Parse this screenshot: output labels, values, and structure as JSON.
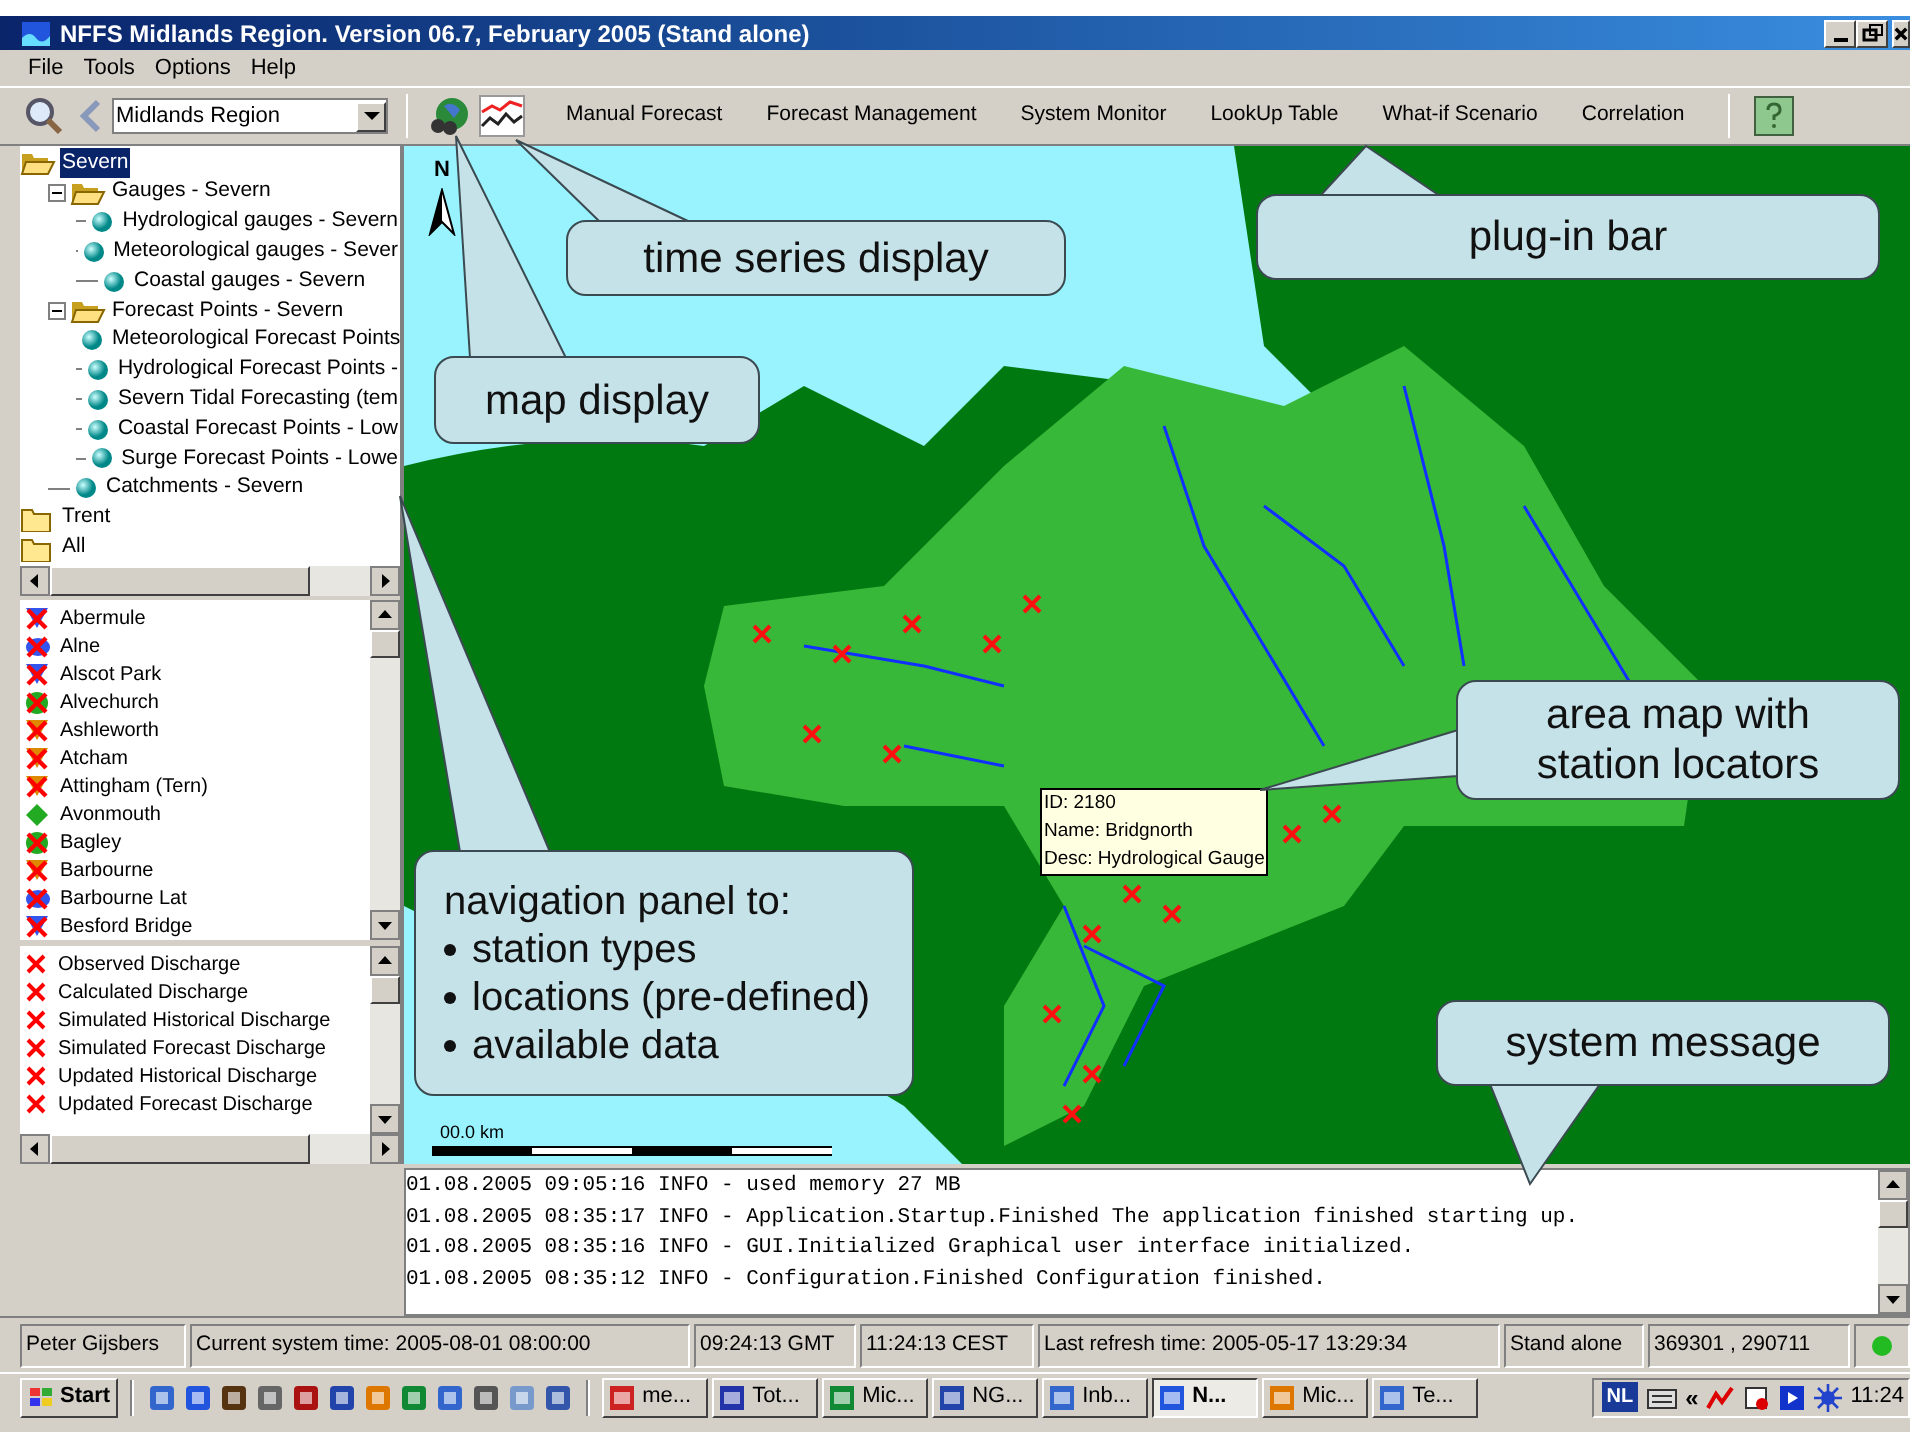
{
  "window": {
    "title": "NFFS Midlands Region. Version 06.7, February 2005  (Stand alone)"
  },
  "menu": [
    "File",
    "Tools",
    "Options",
    "Help"
  ],
  "toolbar": {
    "region": "Midlands Region",
    "plugins": [
      "Manual Forecast",
      "Forecast Management",
      "System Monitor",
      "LookUp Table",
      "What-if Scenario",
      "Correlation"
    ]
  },
  "tree": [
    {
      "label": "Severn",
      "kind": "folder",
      "expanded": true,
      "selected": true,
      "children": [
        {
          "label": "Gauges - Severn",
          "kind": "folder",
          "expanded": true,
          "selected": false,
          "children": [
            {
              "label": "Hydrological gauges - Severn",
              "kind": "layer",
              "selected": false
            },
            {
              "label": "Meteorological gauges - Sever",
              "kind": "layer",
              "selected": false
            },
            {
              "label": "Coastal gauges - Severn",
              "kind": "layer",
              "selected": false
            }
          ]
        },
        {
          "label": "Forecast Points - Severn",
          "kind": "folder",
          "expanded": true,
          "selected": false,
          "children": [
            {
              "label": "Meteorological Forecast Points",
              "kind": "layer",
              "selected": false
            },
            {
              "label": "Hydrological Forecast Points -",
              "kind": "layer",
              "selected": false
            },
            {
              "label": "Severn Tidal Forecasting (tem",
              "kind": "layer",
              "selected": false
            },
            {
              "label": "Coastal Forecast Points - Low",
              "kind": "layer",
              "selected": false
            },
            {
              "label": "Surge Forecast Points - Lowe",
              "kind": "layer",
              "selected": false
            }
          ]
        },
        {
          "label": "Catchments - Severn",
          "kind": "layer",
          "selected": false
        }
      ]
    },
    {
      "label": "Trent",
      "kind": "folder",
      "expanded": false,
      "selected": false
    },
    {
      "label": "All",
      "kind": "folder",
      "expanded": false,
      "selected": false
    }
  ],
  "stations": [
    {
      "name": "Abermule",
      "kind": "triangle",
      "color": "#3355ee",
      "crossed": true
    },
    {
      "name": "Alne",
      "kind": "blob",
      "color": "#3355ee",
      "crossed": true
    },
    {
      "name": "Alscot Park",
      "kind": "triangle",
      "color": "#3355ee",
      "crossed": true
    },
    {
      "name": "Alvechurch",
      "kind": "circle",
      "color": "#22aa22",
      "crossed": true
    },
    {
      "name": "Ashleworth",
      "kind": "triangle",
      "color": "#dd8800",
      "crossed": true
    },
    {
      "name": "Atcham",
      "kind": "triangle",
      "color": "#dd8800",
      "crossed": true
    },
    {
      "name": "Attingham (Tern)",
      "kind": "triangle",
      "color": "#dd8800",
      "crossed": true
    },
    {
      "name": "Avonmouth",
      "kind": "diamond",
      "color": "#22aa22",
      "crossed": false
    },
    {
      "name": "Bagley",
      "kind": "circle",
      "color": "#22aa22",
      "crossed": true
    },
    {
      "name": "Barbourne",
      "kind": "triangle",
      "color": "#dd8800",
      "crossed": true
    },
    {
      "name": "Barbourne Lat",
      "kind": "blob",
      "color": "#3355ee",
      "crossed": true
    },
    {
      "name": "Besford Bridge",
      "kind": "triangle",
      "color": "#3355ee",
      "crossed": true
    }
  ],
  "data_series": [
    "Observed Discharge",
    "Calculated Discharge",
    "Simulated Historical Discharge",
    "Simulated Forecast Discharge",
    "Updated Historical Discharge",
    "Updated Forecast Discharge"
  ],
  "map": {
    "kind": "picture",
    "north": "N",
    "scale": "00.0 km",
    "tooltip": [
      "ID: 2180",
      "Name: Bridgnorth",
      "Desc: Hydrological Gauge"
    ]
  },
  "log": [
    "01.08.2005 09:05:16 INFO - used memory 27 MB",
    "01.08.2005 08:35:17 INFO - Application.Startup.Finished The application finished starting up.",
    "01.08.2005 08:35:16 INFO - GUI.Initialized Graphical user interface initialized.",
    "01.08.2005 08:35:12 INFO - Configuration.Finished Configuration finished."
  ],
  "status_bar": [
    "Peter Gijsbers",
    "Current system time: 2005-08-01 08:00:00",
    "09:24:13 GMT",
    "11:24:13 CEST",
    "Last refresh time: 2005-05-17 13:29:34",
    "Stand alone",
    "369301 , 290711"
  ],
  "taskbar": {
    "start": "Start",
    "tasks": [
      {
        "label": "me...",
        "selected": false
      },
      {
        "label": "Tot...",
        "selected": false
      },
      {
        "label": "Mic...",
        "selected": false
      },
      {
        "label": "NG...",
        "selected": false
      },
      {
        "label": "Inb...",
        "selected": false
      },
      {
        "label": "N...",
        "selected": true
      },
      {
        "label": "Mic...",
        "selected": false
      },
      {
        "label": "Te...",
        "selected": false
      }
    ],
    "language": "NL",
    "chevron": "«",
    "clock": "11:24"
  },
  "callouts": [
    {
      "text": "time series display"
    },
    {
      "text": "plug-in bar"
    },
    {
      "text": "map display"
    },
    {
      "text": "area map with station locators"
    },
    {
      "text": "navigation panel to:",
      "bullets": [
        "station types",
        "locations (pre-defined)",
        "available data"
      ]
    },
    {
      "text": "system message"
    }
  ]
}
